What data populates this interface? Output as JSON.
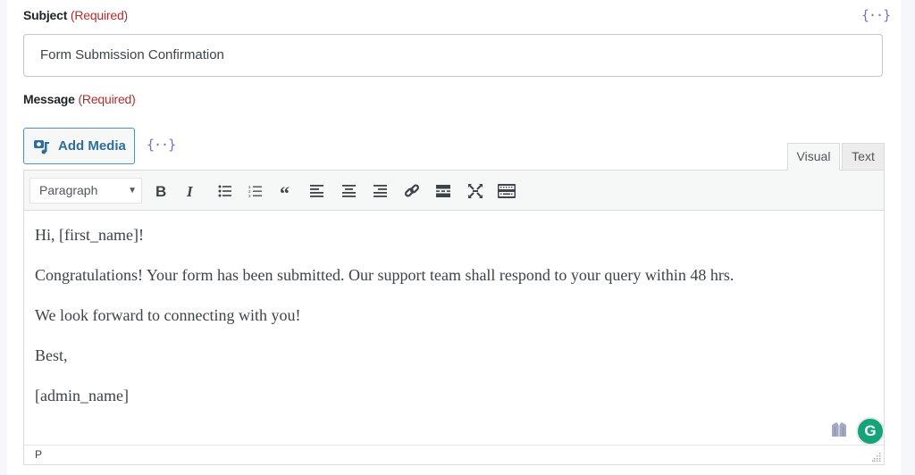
{
  "subject": {
    "label": "Subject",
    "required": "(Required)",
    "value": "Form Submission Confirmation",
    "merge_tag_icon": "{··}"
  },
  "message": {
    "label": "Message",
    "required": "(Required)",
    "add_media_label": "Add Media",
    "merge_tag_icon": "{··}",
    "tabs": [
      {
        "label": "Visual",
        "active": true
      },
      {
        "label": "Text",
        "active": false
      }
    ],
    "toolbar": {
      "format_select": "Paragraph",
      "buttons": [
        "bold",
        "italic",
        "bulleted-list",
        "numbered-list",
        "blockquote",
        "align-left",
        "align-center",
        "align-right",
        "insert-link",
        "read-more",
        "fullscreen",
        "toolbar-toggle"
      ]
    },
    "body": [
      "Hi, [first_name]!",
      "Congratulations! Your form has been submitted. Our support team shall respond to your query within 48 hrs.",
      "We look forward to connecting with you!",
      "Best,",
      "[admin_name]"
    ],
    "status_path": "P",
    "grammarly_letter": "G"
  },
  "colors": {
    "required": "#b32d2e",
    "accent": "#2f6e99",
    "grammarly": "#15a379"
  }
}
